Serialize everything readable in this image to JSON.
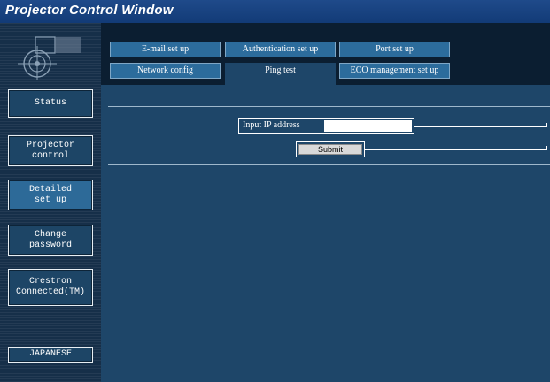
{
  "window": {
    "title": "Projector Control Window"
  },
  "sidebar": {
    "logo_icon": "network-globe-logo",
    "items": [
      {
        "label": "Status"
      },
      {
        "label": "Projector\ncontrol"
      },
      {
        "label": "Detailed\nset up"
      },
      {
        "label": "Change\npassword"
      },
      {
        "label": "Crestron\nConnected(TM)"
      }
    ],
    "language_label": "JAPANESE"
  },
  "tabs": {
    "row1": [
      "E-mail set up",
      "Authentication set up",
      "Port set up"
    ],
    "row2": [
      "Network config",
      "Ping test",
      "ECO management set up"
    ],
    "active": "Ping test"
  },
  "ping": {
    "ip_label": "Input IP address",
    "ip_value": "",
    "submit_label": "Submit"
  },
  "colors": {
    "titlebar": "#123b77",
    "sidebar": "#162f49",
    "main_panel": "#1e4669",
    "tab": "#2c6c9c",
    "tabs_background": "#0b1e31"
  }
}
